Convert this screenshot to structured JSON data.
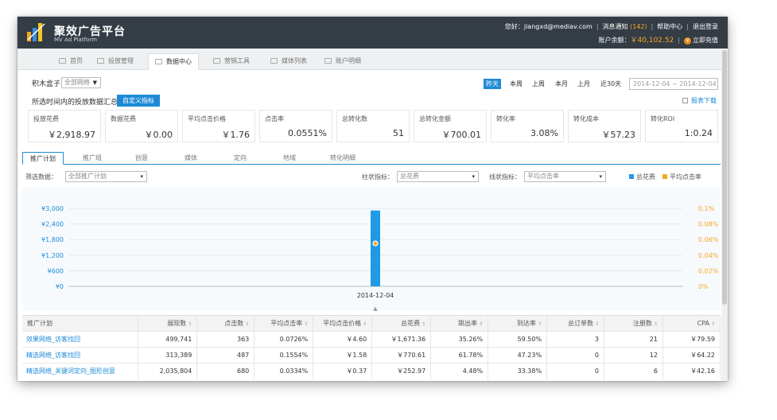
{
  "header": {
    "brand": "聚效广告平台",
    "brand_sub": "MV Ad Platform",
    "greeting": "您好：jiangxd@mediav.com",
    "notice_label": "消息通知",
    "notice_count": "(142)",
    "help": "帮助中心",
    "logout": "退出登录",
    "balance_label": "账户余额：",
    "balance_value": "￥40,102.52",
    "recharge": "立即充值"
  },
  "tabs": [
    "首页",
    "投放管理",
    "数据中心",
    "营销工具",
    "媒体列表",
    "账户明细"
  ],
  "filter_bar": {
    "label": "积木盒子",
    "network_select": "全部网络",
    "ranges": [
      "昨天",
      "本周",
      "上周",
      "本月",
      "上月",
      "近30天"
    ],
    "date_range": "2014-12-04 ~ 2014-12-04"
  },
  "summary_bar": {
    "label": "所选时间内的投放数据汇总",
    "custom_button": "自定义指标",
    "download": "报表下载"
  },
  "cards": [
    {
      "title": "投放花费",
      "value": "￥2,918.97"
    },
    {
      "title": "数据花费",
      "value": "￥0.00"
    },
    {
      "title": "平均点击价格",
      "value": "￥1.76"
    },
    {
      "title": "点击率",
      "value": "0.0551%"
    },
    {
      "title": "总转化数",
      "value": "51"
    },
    {
      "title": "总转化金额",
      "value": "￥700.01"
    },
    {
      "title": "转化率",
      "value": "3.08%"
    },
    {
      "title": "转化成本",
      "value": "￥57.23"
    },
    {
      "title": "转化ROI",
      "value": "1:0.24"
    }
  ],
  "subtabs": [
    "推广计划",
    "推广组",
    "创意",
    "媒体",
    "定向",
    "地域",
    "转化明细"
  ],
  "chart_filter": {
    "filter_label": "筛选数据：",
    "filter_value": "全部推广计划",
    "bar_label": "柱状指标：",
    "bar_value": "总花费",
    "line_label": "线状指标：",
    "line_value": "平均点击率",
    "legend_bar": "总花费",
    "legend_line": "平均点击率"
  },
  "colors": {
    "accent": "#1e8ad6",
    "bar": "#1e9ae6",
    "line": "#f5a623",
    "header_bg": "#343d46"
  },
  "chart_data": {
    "type": "bar",
    "categories": [
      "2014-12-04"
    ],
    "series": [
      {
        "name": "总花费",
        "type": "bar",
        "values": [
          2918.97
        ]
      },
      {
        "name": "平均点击率",
        "type": "line",
        "values": [
          0.0551
        ]
      }
    ],
    "y_left_ticks": [
      "¥3,000",
      "¥2,400",
      "¥1,800",
      "¥1,200",
      "¥600",
      "¥0"
    ],
    "y_left_lim": [
      0,
      3000
    ],
    "y_right_ticks": [
      "0.1%",
      "0.08%",
      "0.06%",
      "0.04%",
      "0.02%",
      "0%"
    ],
    "y_right_lim": [
      0,
      0.1
    ]
  },
  "table": {
    "headers": [
      "推广计划",
      "展现数",
      "点击数",
      "平均点击率",
      "平均点击价格",
      "总花费",
      "跳出率",
      "到达率",
      "总订单数",
      "注册数",
      "CPA"
    ],
    "rows": [
      [
        "效果网络_访客找回",
        "499,741",
        "363",
        "0.0726%",
        "￥4.60",
        "￥1,671.36",
        "35.26%",
        "59.50%",
        "3",
        "21",
        "￥79.59"
      ],
      [
        "精选网络_访客找回",
        "313,389",
        "487",
        "0.1554%",
        "￥1.58",
        "￥770.61",
        "61.78%",
        "47.23%",
        "0",
        "12",
        "￥64.22"
      ],
      [
        "精选网络_关键词定向_图形创意",
        "2,035,804",
        "680",
        "0.0334%",
        "￥0.37",
        "￥252.97",
        "4.48%",
        "33.38%",
        "0",
        "6",
        "￥42.16"
      ]
    ]
  }
}
